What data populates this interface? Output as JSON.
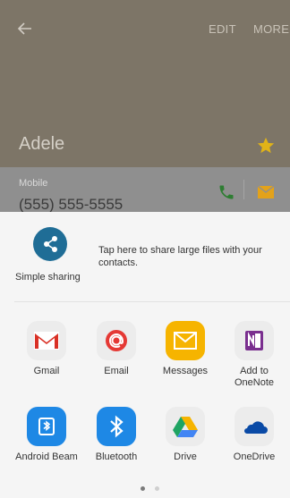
{
  "header": {
    "edit_label": "EDIT",
    "more_label": "MORE",
    "contact_name": "Adele"
  },
  "contact": {
    "phone_type": "Mobile",
    "phone_number": "(555) 555-5555"
  },
  "share": {
    "simple_sharing_label": "Simple sharing",
    "simple_sharing_desc": "Tap here to share large files with your contacts.",
    "apps": [
      {
        "label": "Gmail",
        "icon": "gmail-icon"
      },
      {
        "label": "Email",
        "icon": "email-icon"
      },
      {
        "label": "Messages",
        "icon": "messages-icon"
      },
      {
        "label": "Add to OneNote",
        "icon": "onenote-icon"
      },
      {
        "label": "Android Beam",
        "icon": "android-beam-icon"
      },
      {
        "label": "Bluetooth",
        "icon": "bluetooth-icon"
      },
      {
        "label": "Drive",
        "icon": "drive-icon"
      },
      {
        "label": "OneDrive",
        "icon": "onedrive-icon"
      }
    ],
    "page_count": 2,
    "current_page": 1
  },
  "colors": {
    "header_bg": "#7d7567",
    "accent_star": "#e0b318",
    "call_green": "#2e7d32",
    "message_orange": "#e3a21a"
  }
}
